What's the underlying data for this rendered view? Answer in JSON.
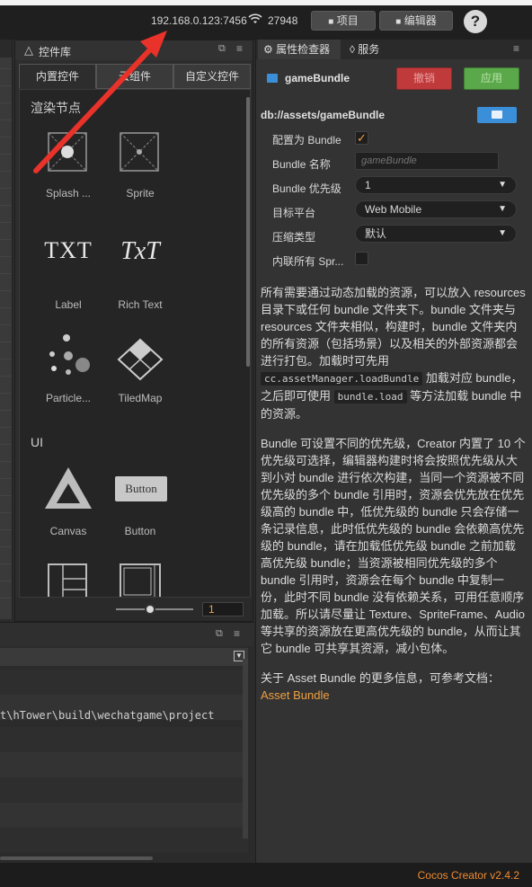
{
  "topbar": {
    "ip": "192.168.0.123:7456",
    "client_count": "27948",
    "project_button": "项目",
    "editor_button": "编辑器",
    "help_icon": "?"
  },
  "library": {
    "title": "控件库",
    "tabs": [
      "内置控件",
      "云组件",
      "自定义控件"
    ],
    "sections": {
      "render": "渲染节点",
      "ui": "UI"
    },
    "items": {
      "splash": "Splash ...",
      "sprite": "Sprite",
      "label": "Label",
      "richtext": "Rich Text",
      "particle": "Particle...",
      "tiledmap": "TiledMap",
      "canvas": "Canvas",
      "button": "Button"
    },
    "label_icon_text": "TXT",
    "richtext_icon_text": "TxT",
    "button_icon_text": "Button",
    "zoom_value": "1"
  },
  "console": {
    "path": "t\\hTower\\build\\wechatgame\\project"
  },
  "inspector": {
    "tab_inspector": "属性检查器",
    "tab_services": "服务",
    "asset_name": "gameBundle",
    "revert_button": "撤销",
    "apply_button": "应用",
    "asset_path": "db://assets/gameBundle",
    "props": {
      "is_bundle_label": "配置为 Bundle",
      "bundle_name_label": "Bundle 名称",
      "bundle_name_placeholder": "gameBundle",
      "priority_label": "Bundle 优先级",
      "priority_value": "1",
      "platform_label": "目标平台",
      "platform_value": "Web Mobile",
      "compress_label": "压缩类型",
      "compress_value": "默认",
      "inline_label": "内联所有 Spr..."
    },
    "desc1_a": "所有需要通过动态加载的资源，可以放入 resources 目录下或任何 bundle 文件夹下。bundle 文件夹与 resources 文件夹相似，构建时，bundle 文件夹内的所有资源（包括场景）以及相关的外部资源都会进行打包。加载时可先用",
    "desc1_code1": "cc.assetManager.loadBundle",
    "desc1_b": "加载对应 bundle，之后即可使用",
    "desc1_code2": "bundle.load",
    "desc1_c": "等方法加载 bundle 中的资源。",
    "desc2": "Bundle 可设置不同的优先级，Creator 内置了 10 个优先级可选择，编辑器构建时将会按照优先级从大到小对 bundle 进行依次构建，当同一个资源被不同优先级的多个 bundle 引用时，资源会优先放在优先级高的 bundle 中，低优先级的 bundle 只会存储一条记录信息，此时低优先级的 bundle 会依赖高优先级的 bundle，请在加载低优先级 bundle 之前加载高优先级 bundle；当资源被相同优先级的多个 bundle 引用时，资源会在每个 bundle 中复制一份，此时不同 bundle 没有依赖关系，可用任意顺序加载。所以请尽量让 Texture、SpriteFrame、Audio 等共享的资源放在更高优先级的 bundle，从而让其它 bundle 可共享其资源，减小包体。",
    "desc3": "关于 Asset Bundle 的更多信息，可参考文档：",
    "doc_link": "Asset Bundle"
  },
  "status": {
    "version": "Cocos Creator v2.4.2"
  },
  "colors": {
    "accent_orange": "#f0a040",
    "revert_red": "#c0393b",
    "apply_green": "#5aa84a",
    "folder_blue": "#3a8fd8",
    "arrow_red": "#e8322a"
  }
}
